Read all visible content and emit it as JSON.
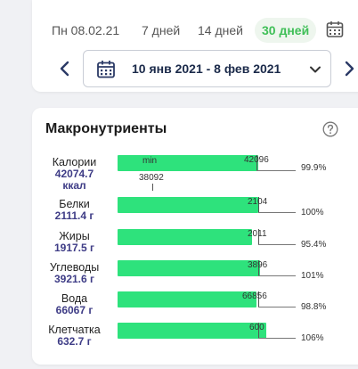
{
  "period": {
    "tabs": [
      {
        "label": "Пн 08.02.21",
        "active": false
      },
      {
        "label": "7 дней",
        "active": false
      },
      {
        "label": "14 дней",
        "active": false
      },
      {
        "label": "30 дней",
        "active": true
      }
    ],
    "range_label": "10 янв 2021 - 8 фев 2021",
    "accent_color": "#3fbf57"
  },
  "macros": {
    "title": "Макронутриенты",
    "bar_color": "#2ee27c",
    "value_color": "#3e3c86",
    "rows": [
      {
        "name": "Калории",
        "value": "42074.7",
        "unit": "ккал",
        "target": "42096",
        "percent": "99.9%",
        "fill": 0.999,
        "min_label": "min",
        "min_value": "38092"
      },
      {
        "name": "Белки",
        "value": "2111.4 г",
        "target": "2104",
        "percent": "100%",
        "fill": 1.0
      },
      {
        "name": "Жиры",
        "value": "1917.5 г",
        "target": "2011",
        "percent": "95.4%",
        "fill": 0.954
      },
      {
        "name": "Углеводы",
        "value": "3921.6 г",
        "target": "3896",
        "percent": "101%",
        "fill": 1.01
      },
      {
        "name": "Вода",
        "value": "66067 г",
        "target": "66856",
        "percent": "98.8%",
        "fill": 0.988
      },
      {
        "name": "Клетчатка",
        "value": "632.7 г",
        "target": "600",
        "percent": "106%",
        "fill": 1.06
      }
    ]
  }
}
